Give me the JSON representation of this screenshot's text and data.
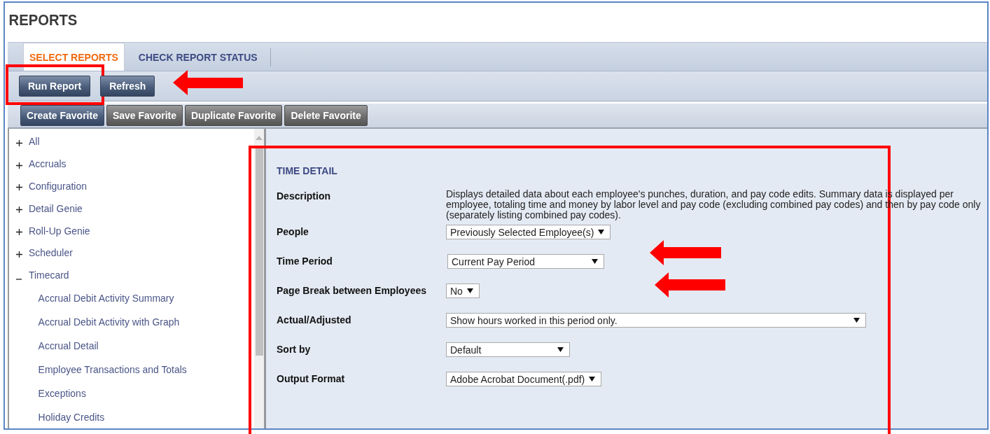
{
  "title": "REPORTS",
  "tabs": [
    {
      "label": "SELECT REPORTS",
      "selected": true
    },
    {
      "label": "CHECK REPORT STATUS",
      "selected": false
    }
  ],
  "actions": [
    {
      "label": "Run Report",
      "kind": "primary"
    },
    {
      "label": "Refresh",
      "kind": "primary"
    }
  ],
  "favorites": [
    {
      "label": "Create Favorite",
      "disabled": false
    },
    {
      "label": "Save Favorite",
      "disabled": true
    },
    {
      "label": "Duplicate Favorite",
      "disabled": true
    },
    {
      "label": "Delete Favorite",
      "disabled": true
    }
  ],
  "tree": [
    {
      "label": "All",
      "expanded": false
    },
    {
      "label": "Accruals",
      "expanded": false
    },
    {
      "label": "Configuration",
      "expanded": false
    },
    {
      "label": "Detail Genie",
      "expanded": false
    },
    {
      "label": "Roll-Up Genie",
      "expanded": false
    },
    {
      "label": "Scheduler",
      "expanded": false
    },
    {
      "label": "Timecard",
      "expanded": true,
      "children": [
        {
          "label": "Accrual Debit Activity Summary"
        },
        {
          "label": "Accrual Debit Activity with Graph"
        },
        {
          "label": "Accrual Detail"
        },
        {
          "label": "Employee Transactions and Totals"
        },
        {
          "label": "Exceptions"
        },
        {
          "label": "Holiday Credits"
        }
      ]
    }
  ],
  "report": {
    "title": "TIME DETAIL",
    "fields": [
      {
        "label": "Description",
        "kind": "text",
        "value": "Displays detailed data about each employee's punches, duration, and pay code edits. Summary data is displayed per employee, totaling time and money by labor level and pay code (excluding combined pay codes) and then by pay code only (separately listing combined pay codes)."
      },
      {
        "label": "People",
        "kind": "select",
        "value": "Previously Selected Employee(s)"
      },
      {
        "label": "Time Period",
        "kind": "select",
        "value": "Current Pay Period"
      },
      {
        "label": "Page Break between Employees",
        "kind": "select",
        "value": "No"
      },
      {
        "label": "Actual/Adjusted",
        "kind": "select",
        "value": "Show hours worked in this period only."
      },
      {
        "label": "Sort by",
        "kind": "select",
        "value": "Default"
      },
      {
        "label": "Output Format",
        "kind": "select",
        "value": "Adobe Acrobat Document(.pdf)"
      }
    ]
  }
}
